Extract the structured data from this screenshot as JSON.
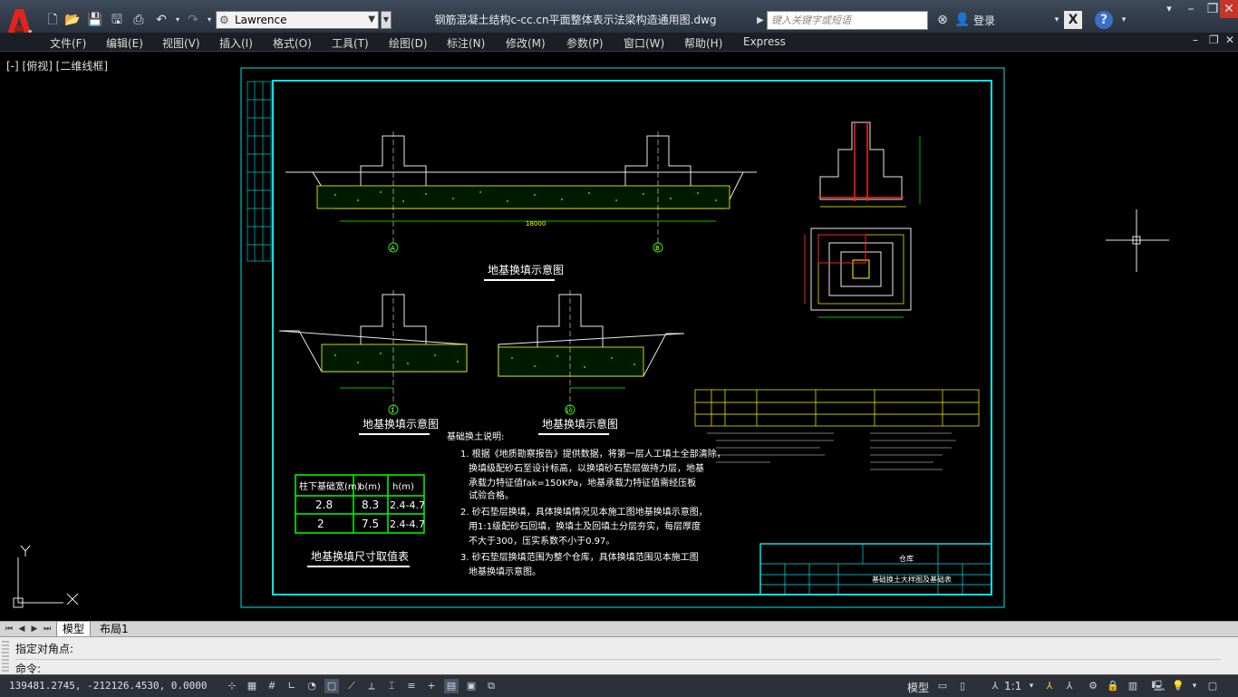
{
  "window": {
    "title": "钢筋混凝土结构c-cc.cn平面整体表示法梁构造通用图.dwg",
    "workspace": "Lawrence",
    "search_placeholder": "键入关键字或短语",
    "login_label": "登录"
  },
  "menu": [
    "文件(F)",
    "编辑(E)",
    "视图(V)",
    "插入(I)",
    "格式(O)",
    "工具(T)",
    "绘图(D)",
    "标注(N)",
    "修改(M)",
    "参数(P)",
    "窗口(W)",
    "帮助(H)",
    "Express"
  ],
  "viewport_label": "[-] [俯视] [二维线框]",
  "drawing": {
    "section_titles": [
      "地基换填示意图",
      "地基换填示意图",
      "地基换填示意图",
      "地基换填尺寸取值表"
    ],
    "axis_labels": [
      "A",
      "B",
      "1",
      "10"
    ],
    "dimension_label": "18000",
    "table": {
      "headers": [
        "柱下基础宽(m)",
        "b(m)",
        "h(m)"
      ],
      "rows": [
        [
          "2.8",
          "8.3",
          "2.4-4.7"
        ],
        [
          "2",
          "7.5",
          "2.4-4.7"
        ]
      ]
    },
    "notes_title": "基础换土说明:",
    "notes": [
      "1. 根据《地质勘察报告》提供数据，将第一层人工填土全部清除，",
      "换填级配砂石至设计标高，以换填砂石垫层做持力层，地基",
      "承载力特征值fak=150KPa，地基承载力特征值需经压板",
      "试验合格。",
      "2. 砂石垫层换填，具体换填情况见本施工图地基换填示意图，",
      "用1:1级配砂石回填，换填土及回填土分层夯实，每层厚度",
      "不大于300，压实系数不小于0.97。",
      "3. 砂石垫层换填范围为整个仓库，具体换填范围见本施工图",
      "地基换填示意图。"
    ],
    "title_block_project": "仓库",
    "title_block_name": "基础换土大样图及基础表"
  },
  "tabs": {
    "model": "模型",
    "layout": "布局1"
  },
  "command": {
    "line1": "指定对角点:",
    "line2": "命令:"
  },
  "status": {
    "coords": "139481.2745, -212126.4530, 0.0000",
    "model": "模型",
    "scale": "1:1"
  },
  "colors": {
    "cyan": "#00e6e6",
    "yellow": "#ffff00",
    "green": "#00ff00",
    "red": "#ff2020",
    "white": "#ffffff"
  }
}
